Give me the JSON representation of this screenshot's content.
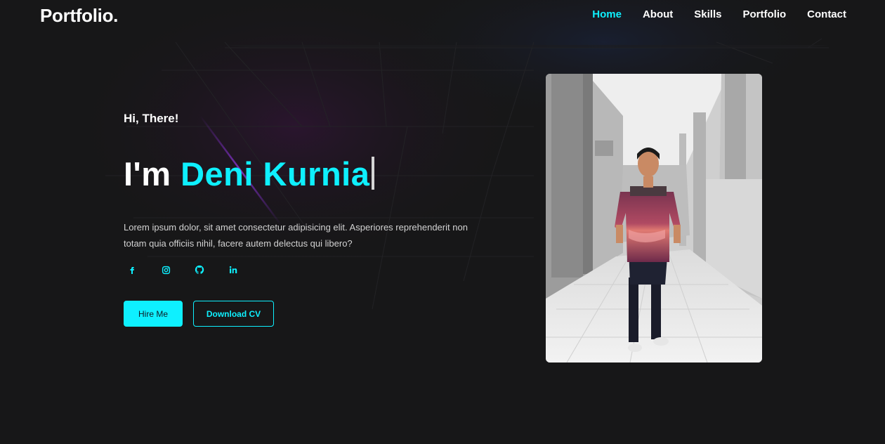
{
  "brand": {
    "logo": "Portfolio."
  },
  "nav": {
    "items": [
      {
        "label": "Home",
        "active": true
      },
      {
        "label": "About",
        "active": false
      },
      {
        "label": "Skills",
        "active": false
      },
      {
        "label": "Portfolio",
        "active": false
      },
      {
        "label": "Contact",
        "active": false
      }
    ]
  },
  "hero": {
    "greeting": "Hi, There!",
    "headline_prefix": "I'm",
    "headline_name": "Deni Kurnia",
    "intro": "Lorem ipsum dolor, sit amet consectetur adipisicing elit. Asperiores reprehenderit non totam quia officiis nihil, facere autem delectus qui libero?",
    "socials": [
      {
        "icon": "facebook-icon"
      },
      {
        "icon": "instagram-icon"
      },
      {
        "icon": "github-icon"
      },
      {
        "icon": "linkedin-icon"
      }
    ],
    "hire_label": "Hire Me",
    "cv_label": "Download CV"
  },
  "colors": {
    "accent": "#0ef0ff",
    "background": "#171718",
    "text": "#ffffff"
  }
}
